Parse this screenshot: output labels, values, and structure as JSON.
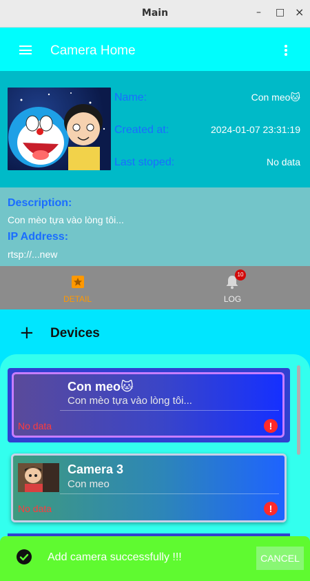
{
  "window": {
    "title": "Main",
    "minimize": "–",
    "maximize": "□",
    "close": "×"
  },
  "appbar": {
    "title": "Camera Home",
    "menu_icon": "menu-icon",
    "more_icon": "more-vert-icon"
  },
  "camera_info": {
    "name_label": "Name:",
    "name_value": "Con meo🐱",
    "created_label": "Created at:",
    "created_value": "2024-01-07 23:31:19",
    "stopped_label": "Last stoped:",
    "stopped_value": "No data",
    "description_label": "Description:",
    "description_value": "Con mèo tựa vào lòng tôi...",
    "ip_label": "IP Address:",
    "ip_value": "rtsp://...new"
  },
  "tabs": [
    {
      "label": "DETAIL",
      "icon": "star-icon",
      "active": true,
      "color": "#ff9800"
    },
    {
      "label": "LOG",
      "icon": "bell-icon",
      "active": false,
      "badge": "10"
    }
  ],
  "devices_section": {
    "title": "Devices",
    "add_icon": "plus-icon"
  },
  "devices": [
    {
      "title": "Con meo🐱",
      "subtitle": "Con mèo tựa vào lòng tôi...",
      "status": "No data"
    },
    {
      "title": "Camera 3",
      "subtitle": "Con meo",
      "status": "No data"
    }
  ],
  "snackbar": {
    "message": "Add camera successfully !!!",
    "action": "CANCEL",
    "icon": "check-circle-icon"
  },
  "colors": {
    "appbar": "#00fdfd",
    "info_bg": "#00bac8",
    "desc_bg": "#73c5c9",
    "tabs_bg": "#8c8c8c",
    "accent_blue": "#1a6dff",
    "snackbar": "#5ffa30",
    "error": "#ff2a2a"
  }
}
